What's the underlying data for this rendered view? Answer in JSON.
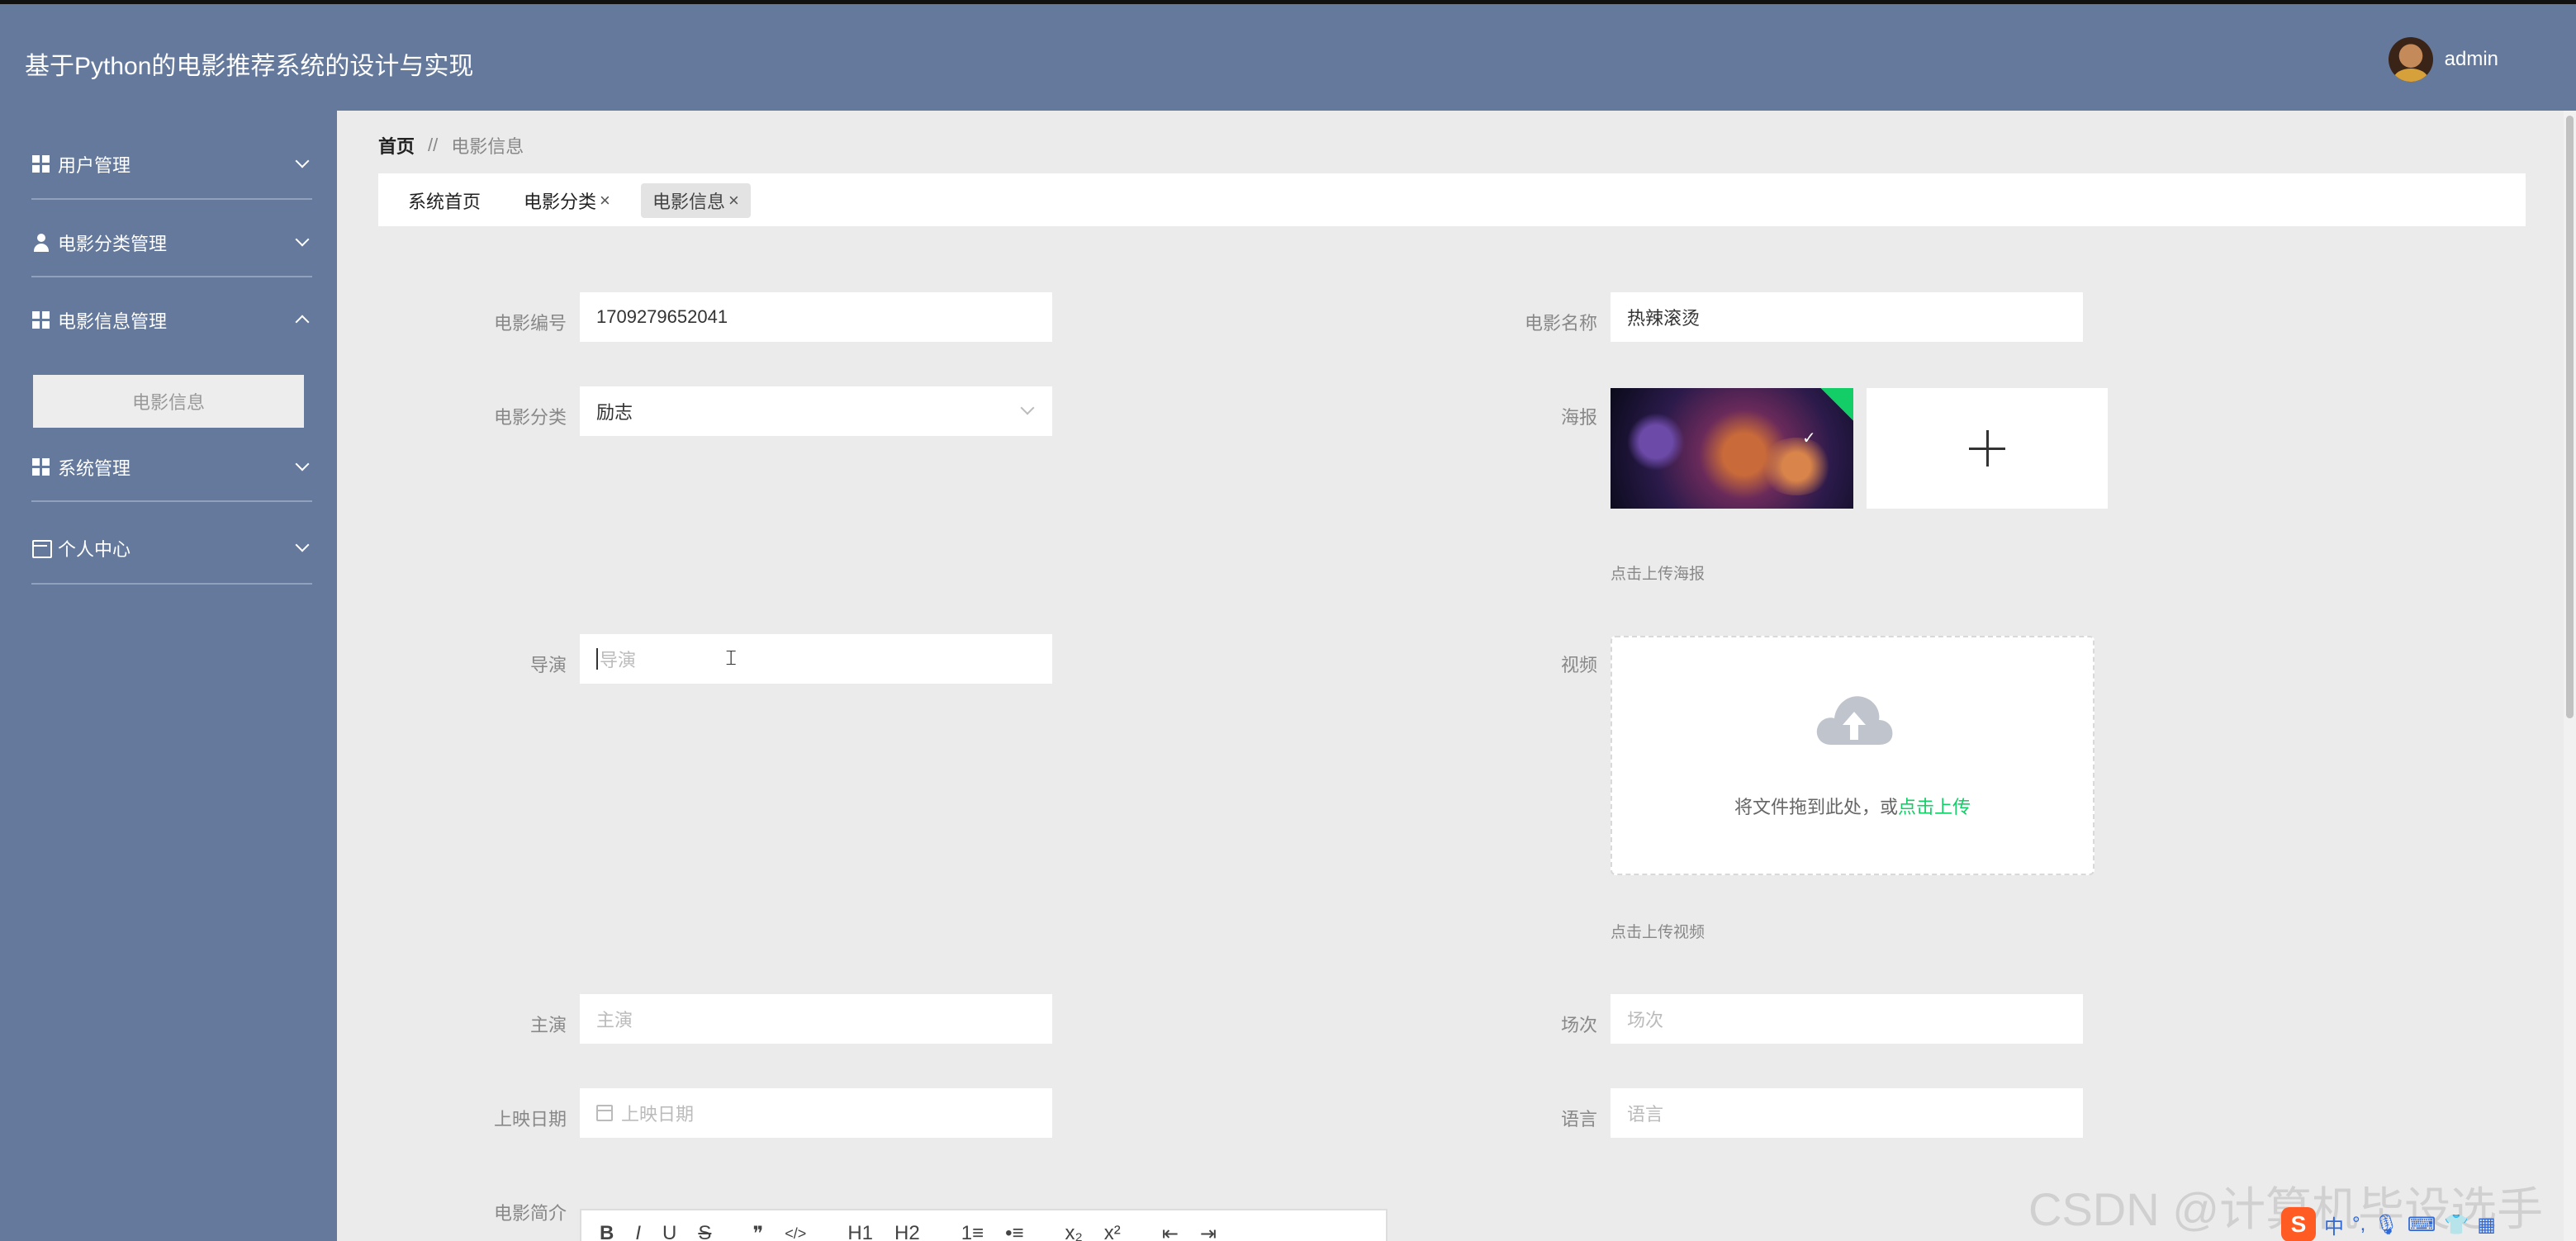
{
  "header": {
    "title": "基于Python的电影推荐系统的设计与实现",
    "username": "admin"
  },
  "sidebar": {
    "items": [
      {
        "label": "用户管理",
        "icon": "grid-icon"
      },
      {
        "label": "电影分类管理",
        "icon": "person-icon"
      },
      {
        "label": "电影信息管理",
        "icon": "grid-icon",
        "expanded": true
      },
      {
        "label": "系统管理",
        "icon": "grid-icon"
      },
      {
        "label": "个人中心",
        "icon": "card-icon"
      }
    ],
    "subitem": "电影信息"
  },
  "breadcrumb": {
    "home": "首页",
    "separator": "//",
    "current": "电影信息"
  },
  "tabs": [
    {
      "label": "系统首页"
    },
    {
      "label": "电影分类",
      "close": "×"
    },
    {
      "label": "电影信息",
      "close": "×",
      "active": true
    }
  ],
  "form": {
    "movie_id": {
      "label": "电影编号",
      "value": "1709279652041"
    },
    "movie_name": {
      "label": "电影名称",
      "value": "热辣滚烫"
    },
    "category": {
      "label": "电影分类",
      "value": "励志"
    },
    "poster": {
      "label": "海报",
      "hint": "点击上传海报"
    },
    "director": {
      "label": "导演",
      "placeholder": "导演"
    },
    "video": {
      "label": "视频",
      "drag_text": "将文件拖到此处，或",
      "drag_link": "点击上传",
      "hint": "点击上传视频"
    },
    "actors": {
      "label": "主演",
      "placeholder": "主演"
    },
    "sessions": {
      "label": "场次",
      "placeholder": "场次"
    },
    "release_date": {
      "label": "上映日期",
      "placeholder": "上映日期"
    },
    "language": {
      "label": "语言",
      "placeholder": "语言"
    },
    "intro": {
      "label": "电影简介"
    }
  },
  "editor_tools": [
    "B",
    "I",
    "U",
    "S",
    "❞",
    "</>",
    "H1",
    "H2",
    "1≡",
    "•≡",
    "x₂",
    "x²",
    "⇤",
    "⇥"
  ],
  "watermark": "CSDN @计算机毕设选手",
  "tray": {
    "logo": "S",
    "ime": "中"
  },
  "colors": {
    "sidebar_bg": "#64799b",
    "accent_green": "#13ce66",
    "content_bg": "#ebebeb"
  }
}
